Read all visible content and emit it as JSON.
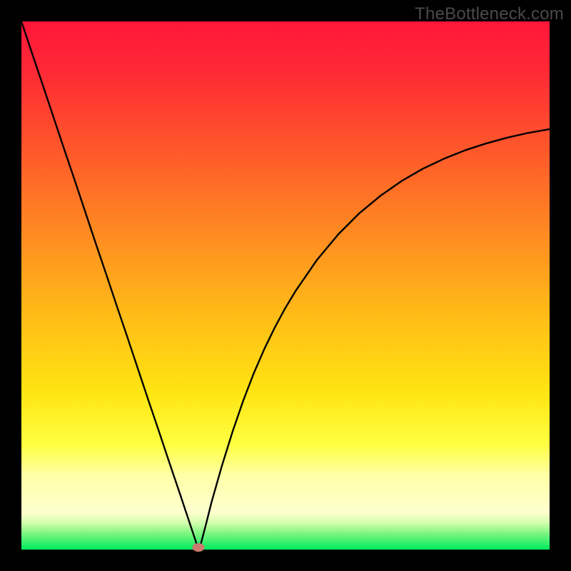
{
  "watermark": "TheBottleneck.com",
  "colors": {
    "bg": "#000000",
    "grad_top": "#ff2040",
    "grad_mid1": "#ff7a30",
    "grad_mid2": "#ffd400",
    "grad_mid3": "#ffff60",
    "grad_band_pale": "#ffffb0",
    "grad_green": "#00ef66",
    "marker": "#cb7a70",
    "curve": "#000000"
  },
  "chart_data": {
    "type": "line",
    "title": "",
    "xlabel": "",
    "ylabel": "",
    "xlim": [
      0,
      100
    ],
    "ylim": [
      0,
      100
    ],
    "x": [
      0,
      2,
      4,
      6,
      8,
      10,
      12,
      14,
      16,
      18,
      20,
      22,
      24,
      26,
      28,
      30,
      31,
      32,
      33,
      33.5,
      34,
      35,
      36,
      38,
      40,
      42,
      44,
      46,
      48,
      50,
      52,
      56,
      60,
      64,
      68,
      72,
      76,
      80,
      84,
      88,
      92,
      96,
      100
    ],
    "values": [
      100,
      94.0,
      88.1,
      82.1,
      76.1,
      70.2,
      64.2,
      58.2,
      52.3,
      46.3,
      40.4,
      34.4,
      28.4,
      22.5,
      16.5,
      10.6,
      7.6,
      4.6,
      1.6,
      0.1,
      1.2,
      5.0,
      9.0,
      16.0,
      22.4,
      28.2,
      33.4,
      38.0,
      42.1,
      45.8,
      49.1,
      54.9,
      59.7,
      63.7,
      67.0,
      69.8,
      72.1,
      74.0,
      75.6,
      76.9,
      78.0,
      78.9,
      79.6
    ],
    "marker": {
      "x": 33.5,
      "y": 0.1
    },
    "annotations": []
  }
}
